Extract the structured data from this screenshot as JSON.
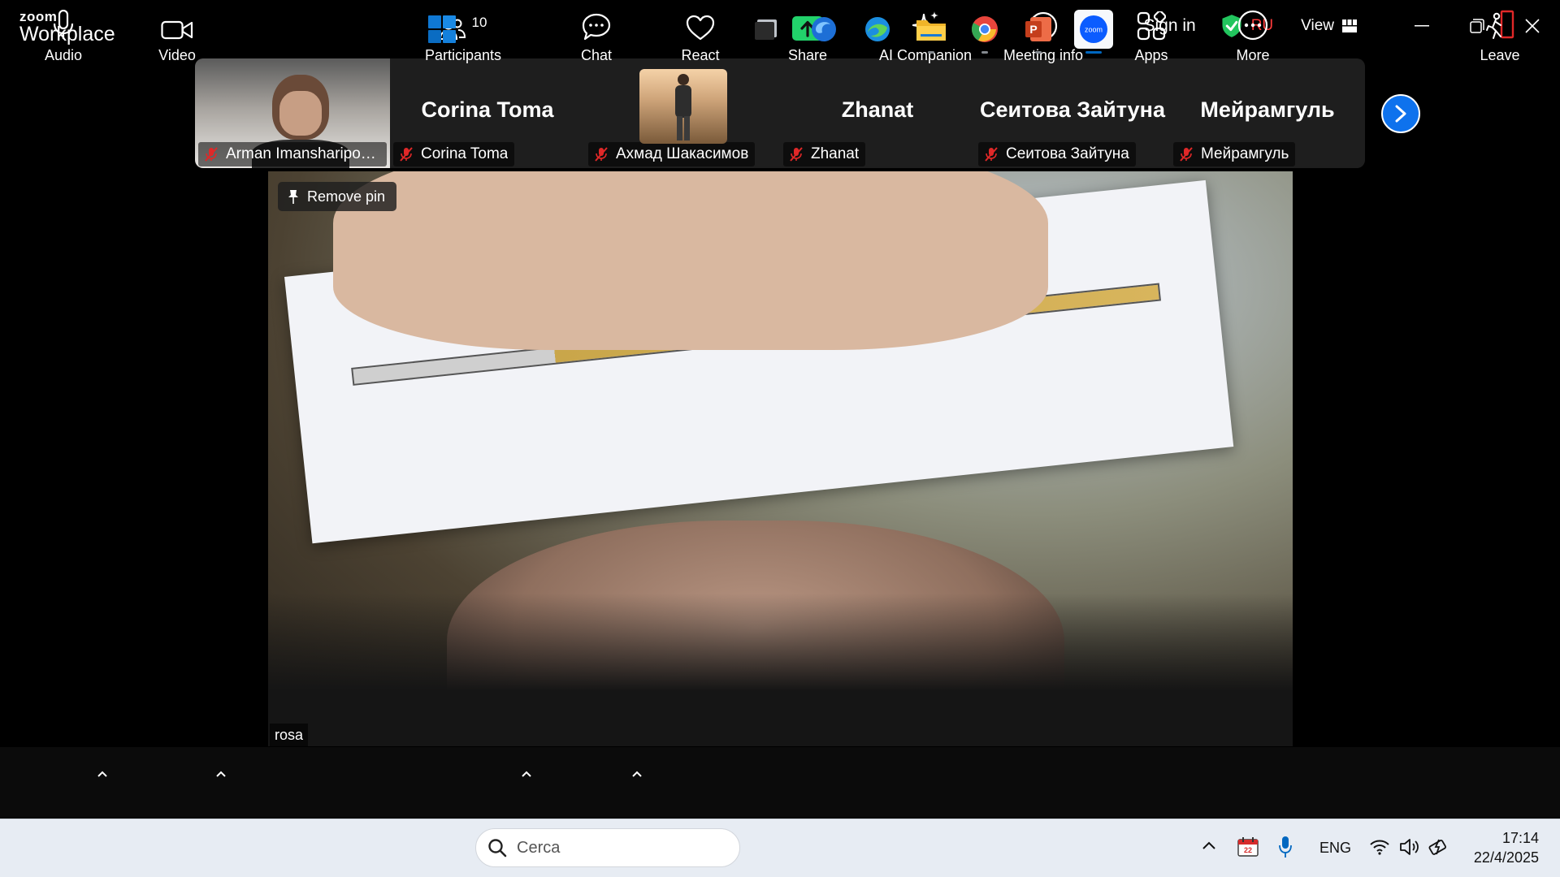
{
  "app": {
    "logo_top": "zoom",
    "logo_bottom": "Workplace",
    "sign_in": "Sign in",
    "region": "RU",
    "view_label": "View"
  },
  "gallery": {
    "tiles": [
      {
        "name": "Arman Imansharipova,...",
        "big_name": "",
        "muted": true,
        "has_video": true
      },
      {
        "name": "Corina Toma",
        "big_name": "Corina Toma",
        "muted": true,
        "has_video": false
      },
      {
        "name": "Ахмад Шакасимов",
        "big_name": "",
        "muted": true,
        "has_photo": true
      },
      {
        "name": "Zhanat",
        "big_name": "Zhanat",
        "muted": true,
        "has_video": false
      },
      {
        "name": "Сеитова Зайтуна",
        "big_name": "Сеитова Зайтуна",
        "muted": true,
        "has_video": false
      },
      {
        "name": "Мейрамгуль",
        "big_name": "Мейрамгуль",
        "muted": true,
        "has_video": false
      }
    ]
  },
  "main_video": {
    "pin_label": "Remove pin",
    "participant": "rosa"
  },
  "toolbar": {
    "audio": "Audio",
    "video": "Video",
    "participants": "Participants",
    "participants_count": "10",
    "chat": "Chat",
    "react": "React",
    "share": "Share",
    "ai_companion": "AI Companion",
    "meeting_info": "Meeting info",
    "apps": "Apps",
    "more": "More",
    "leave": "Leave"
  },
  "taskbar": {
    "search_placeholder": "Cerca",
    "language": "ENG",
    "calendar_day": "22",
    "time": "17:14",
    "date": "22/4/2025"
  },
  "colors": {
    "zoom_blue": "#0e72ed",
    "share_green": "#22d26b",
    "muted_red": "#e02828",
    "leave_red": "#e02828",
    "shield_green": "#22c55e"
  }
}
